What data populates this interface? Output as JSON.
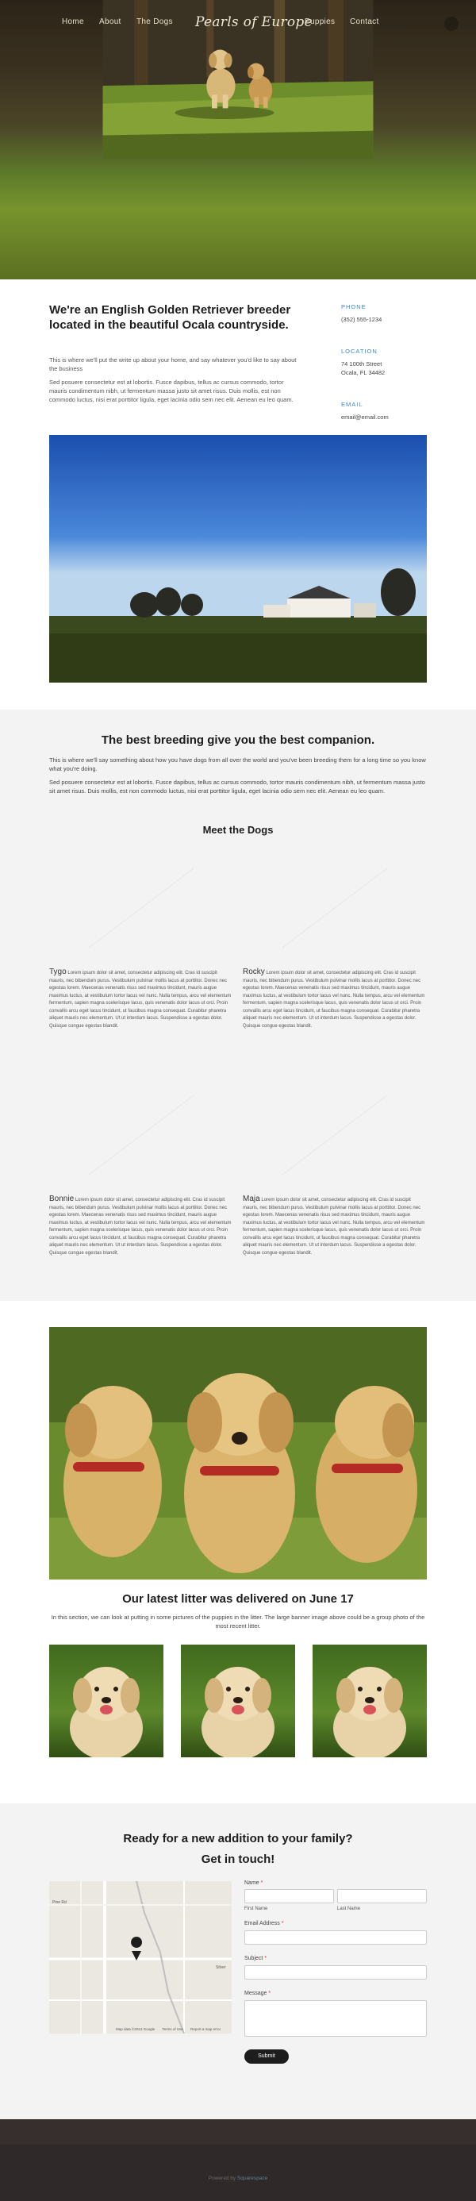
{
  "nav": {
    "items": [
      "Home",
      "About",
      "The Dogs",
      "Puppies",
      "Contact"
    ],
    "logo": "Pearls of Europe"
  },
  "about": {
    "heading": "We're an English Golden Retriever breeder located in the beautiful Ocala countryside.",
    "intro": "This is where we'll put the write up about your home, and say whatever you'd like to say about the business",
    "body": "Sed posuere consectetur est at lobortis. Fusce dapibus, tellus ac cursus commodo, tortor mauris condimentum nibh, ut fermentum massa justo sit amet risus. Duis mollis, est non commodo luctus, nisi erat porttitor ligula, eget lacinia odio sem nec elit. Aenean eu leo quam."
  },
  "contact_info": {
    "phone_label": "PHONE",
    "phone": "(352) 555-1234",
    "location_label": "LOCATION",
    "address_line1": "74 100th Street",
    "address_line2": "Ocala, FL 34482",
    "email_label": "EMAIL",
    "email": "email@email.com"
  },
  "breeding": {
    "heading": "The best breeding give you the best companion.",
    "p1": "This is where we'll say something about how you have dogs from all over the world and you've been breeding them for a long time so you know what you're doing.",
    "p2": "Sed posuere consectetur est at lobortis. Fusce dapibus, tellus ac cursus commodo, tortor mauris condimentum nibh, ut fermentum massa justo sit amet risus. Duis mollis, est non commodo luctus, nisi erat porttitor ligula, eget lacinia odio sem nec elit. Aenean eu leo quam.",
    "meet_heading": "Meet the Dogs",
    "dogs": [
      {
        "name": "Tygo",
        "text": "Lorem ipsum dolor sit amet, consectetur adipiscing elit. Cras id suscipit mauris, nec bibendum purus. Vestibulum pulvinar mollis lacus at porttitor. Donec nec egestas lorem. Maecenas venenatis risus sed maximus tincidunt, mauris augue maximus luctus, at vestibulum tortor lacus vel nunc. Nulla tempus, arcu vel elementum fermentum, sapien magna scelerisque lacus, quis venenatis dolor lacus ut orci. Proin convallis arcu eget lacus tincidunt, ut faucibus magna consequat. Curabitur pharetra aliquet mauris nec elementum. Ut ut interdum lacus. Suspendisse a egestas dolor. Quisque congue egestas blandit."
      },
      {
        "name": "Rocky",
        "text": "Lorem ipsum dolor sit amet, consectetur adipiscing elit. Cras id suscipit mauris, nec bibendum purus. Vestibulum pulvinar mollis lacus at porttitor. Donec nec egestas lorem. Maecenas venenatis risus sed maximus tincidunt, mauris augue maximus luctus, at vestibulum tortor lacus vel nunc. Nulla tempus, arcu vel elementum fermentum, sapien magna scelerisque lacus, quis venenatis dolor lacus ut orci. Proin convallis arcu eget lacus tincidunt, ut faucibus magna consequat. Curabitur pharetra aliquet mauris nec elementum. Ut ut interdum lacus. Suspendisse a egestas dolor. Quisque congue egestas blandit."
      },
      {
        "name": "Bonnie",
        "text": "Lorem ipsum dolor sit amet, consectetur adipiscing elit. Cras id suscipit mauris, nec bibendum purus. Vestibulum pulvinar mollis lacus at porttitor. Donec nec egestas lorem. Maecenas venenatis risus sed maximus tincidunt, mauris augue maximus luctus, at vestibulum tortor lacus vel nunc. Nulla tempus, arcu vel elementum fermentum, sapien magna scelerisque lacus, quis venenatis dolor lacus ut orci. Proin convallis arcu eget lacus tincidunt, ut faucibus magna consequat. Curabitur pharetra aliquet mauris nec elementum. Ut ut interdum lacus. Suspendisse a egestas dolor. Quisque congue egestas blandit."
      },
      {
        "name": "Maja",
        "text": "Lorem ipsum dolor sit amet, consectetur adipiscing elit. Cras id suscipit mauris, nec bibendum purus. Vestibulum pulvinar mollis lacus at porttitor. Donec nec egestas lorem. Maecenas venenatis risus sed maximus tincidunt, mauris augue maximus luctus, at vestibulum tortor lacus vel nunc. Nulla tempus, arcu vel elementum fermentum, sapien magna scelerisque lacus, quis venenatis dolor lacus ut orci. Proin convallis arcu eget lacus tincidunt, ut faucibus magna consequat. Curabitur pharetra aliquet mauris nec elementum. Ut ut interdum lacus. Suspendisse a egestas dolor. Quisque congue egestas blandit."
      }
    ]
  },
  "litter": {
    "heading": "Our latest litter was delivered on June 17",
    "text": "In this section, we can look at putting in some pictures of the puppies in the litter. The large banner image above could be a group photo of the most recent litter."
  },
  "contact_form": {
    "heading1": "Ready for a new addition to your family?",
    "heading2": "Get in touch!",
    "name_label": "Name",
    "first_name": "First Name",
    "last_name": "Last Name",
    "email_label": "Email Address",
    "subject_label": "Subject",
    "message_label": "Message",
    "required_mark": "*",
    "submit": "Submit",
    "map_footer": "Map data ©2013 Google",
    "map_terms": "Terms of Use",
    "map_report": "Report a map error",
    "map_road": "Pine Rd",
    "map_place": "Silver"
  },
  "footer": {
    "powered": "Powered by",
    "link": "Squarespace"
  },
  "colors": {
    "accent": "#3d86c6",
    "footer_bg": "#2f2a29",
    "section_grey": "#f3f3f3"
  }
}
